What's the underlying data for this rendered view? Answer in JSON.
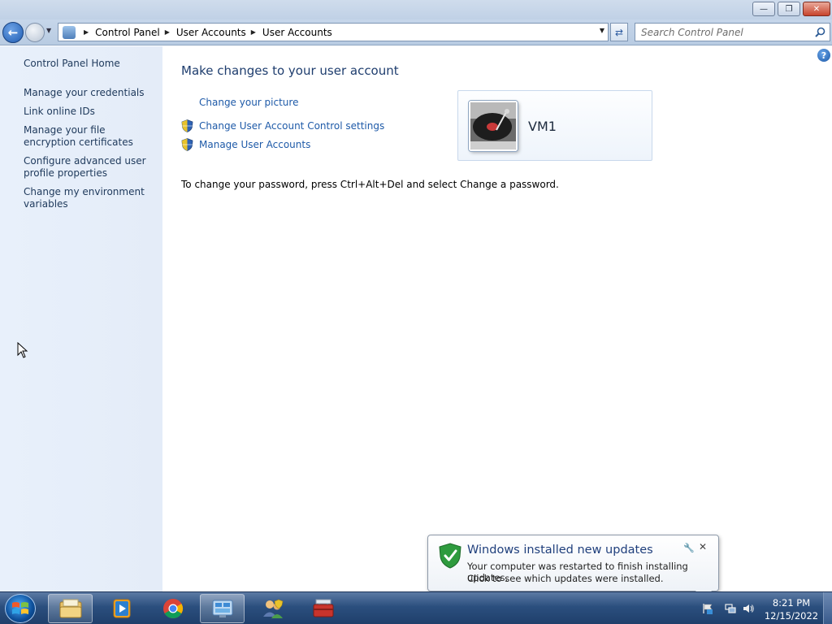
{
  "window": {
    "minimize_label": "—",
    "maximize_label": "❐",
    "close_label": "✕"
  },
  "address_bar": {
    "breadcrumbs": [
      "Control Panel",
      "User Accounts",
      "User Accounts"
    ],
    "icon": "control-panel-icon"
  },
  "search": {
    "placeholder": "Search Control Panel"
  },
  "sidebar": {
    "items": [
      {
        "label": "Control Panel Home"
      },
      {
        "label": "Manage your credentials"
      },
      {
        "label": "Link online IDs"
      },
      {
        "label": "Manage your file encryption certificates"
      },
      {
        "label": "Configure advanced user profile properties"
      },
      {
        "label": "Change my environment variables"
      }
    ]
  },
  "main": {
    "title": "Make changes to your user account",
    "tasks": [
      {
        "label": "Change your picture",
        "icon": ""
      },
      {
        "label": "Change User Account Control settings",
        "icon": "uac-shield-icon"
      },
      {
        "label": "Manage User Accounts",
        "icon": "uac-shield-icon"
      }
    ],
    "password_note": "To change your password, press Ctrl+Alt+Del and select Change a password.",
    "account": {
      "name": "VM1",
      "picture": "turntable-picture"
    }
  },
  "notification": {
    "title": "Windows installed new updates",
    "line1": "Your computer was restarted to finish installing updates.",
    "line2": "Click to see which updates were installed."
  },
  "taskbar": {
    "buttons": [
      "windows-explorer",
      "windows-media-player",
      "google-chrome",
      "control-panel",
      "user-accounts",
      "toolbox"
    ],
    "clock": {
      "time": "8:21 PM",
      "date": "12/15/2022"
    }
  },
  "colors": {
    "link": "#1e5aa8",
    "title": "#1e3d6e",
    "sidebar_bg": "#e6eefa",
    "taskbar": "#2b4f7e"
  }
}
